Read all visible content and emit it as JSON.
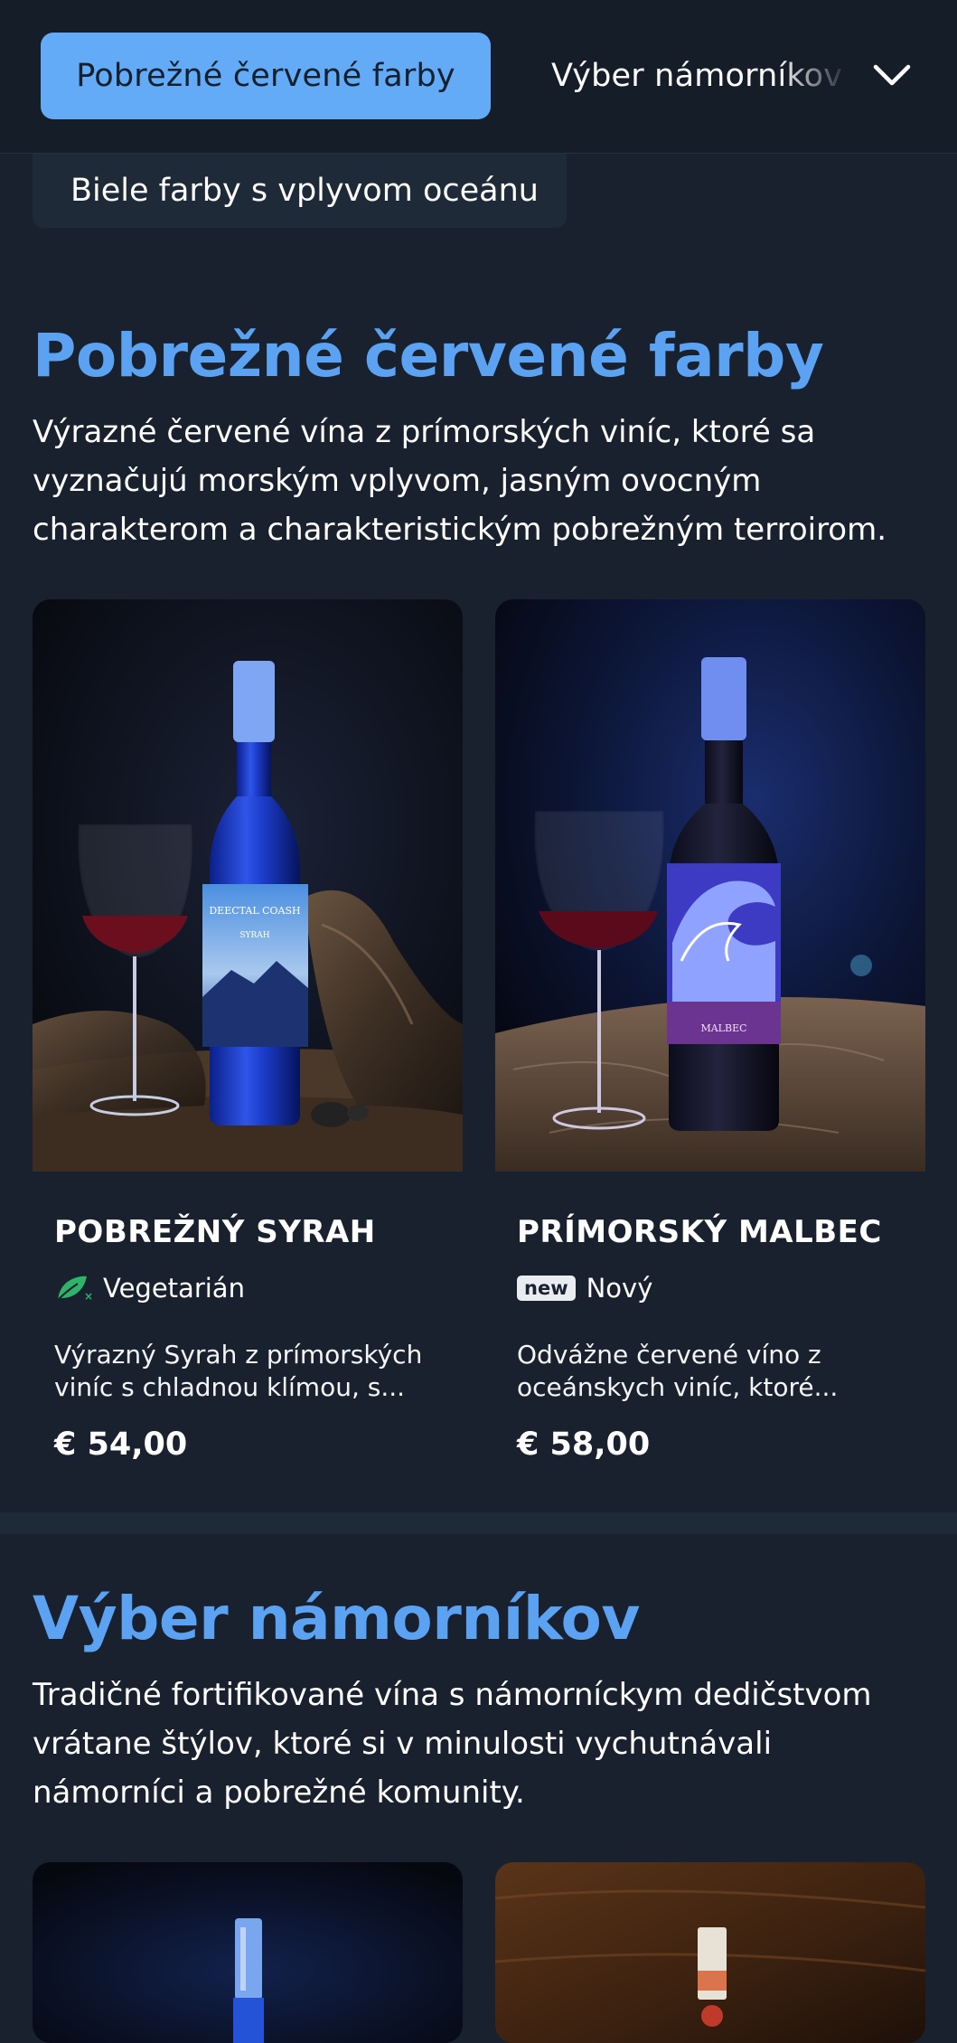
{
  "nav": {
    "active_tab": "Pobrežné červené farby",
    "second_tab": "Výber námorníkov",
    "third_tab": "Biele farby s vplyvom oceánu",
    "expand_icon": "chevron-down-icon"
  },
  "sections": [
    {
      "title": "Pobrežné červené farby",
      "description": "Výrazné červené vína z prímorských viníc, ktoré sa vyznačujú morským vplyvom, jasným ovocným charakterom a charakteristickým pobrežným terroirom.",
      "products": [
        {
          "name": "POBREŽNÝ SYRAH",
          "tag_icon": "vegetarian-leaf-icon",
          "tag": "Vegetarián",
          "description_line1": "Výrazný Syrah z prímorských",
          "description_line2": "viníc s chladnou klímou, s...",
          "price": "€ 54,00",
          "label_text": "DEECTAL COASH",
          "label_sub": "SYRAH"
        },
        {
          "name": "PRÍMORSKÝ MALBEC",
          "tag_badge": "new",
          "tag": "Nový",
          "description_line1": "Odvážne červené víno z",
          "description_line2": "oceánskych viníc, ktoré...",
          "price": "€ 58,00",
          "label_sub": "MALBEC"
        }
      ]
    },
    {
      "title": "Výber námorníkov",
      "description": "Tradičné fortifikované vína s námorníckym dedičstvom vrátane štýlov, ktoré si v minulosti vychutnávali námorníci a pobrežné komunity."
    }
  ],
  "colors": {
    "background": "#18212d",
    "accent": "#5ba3f2",
    "active_tab_bg": "#63aaf7",
    "vegetarian_green": "#2fb36a"
  }
}
